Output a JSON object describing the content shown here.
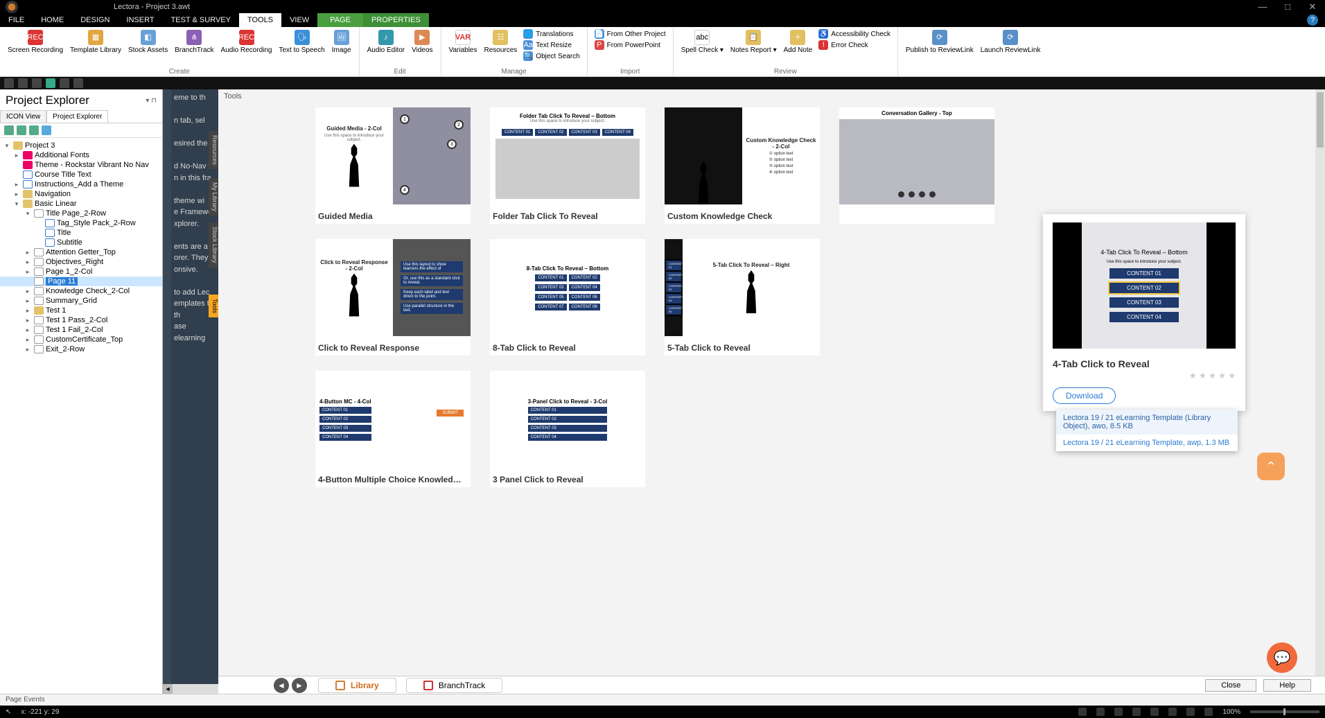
{
  "window": {
    "title": "Lectora - Project 3.awt",
    "buttons": {
      "min": "—",
      "max": "□",
      "close": "✕"
    }
  },
  "menu": {
    "file": "FILE",
    "home": "HOME",
    "design": "DESIGN",
    "insert": "INSERT",
    "test": "TEST & SURVEY",
    "tools": "TOOLS",
    "view": "VIEW",
    "page": "PAGE",
    "properties": "PROPERTIES"
  },
  "ribbon": {
    "groups": {
      "create": "Create",
      "edit": "Edit",
      "manage": "Manage",
      "import": "Import",
      "review": "Review",
      "reviewlink": ""
    },
    "screenRecording": "Screen\nRecording",
    "templateLibrary": "Template\nLibrary",
    "stockAssets": "Stock\nAssets",
    "branchTrack": "BranchTrack",
    "audioRecording": "Audio\nRecording",
    "textToSpeech": "Text to\nSpeech",
    "image": "Image",
    "audioEditor": "Audio\nEditor",
    "videos": "Videos",
    "variables": "Variables",
    "resources": "Resources",
    "translations": "Translations",
    "textResize": "Text Resize",
    "objectSearch": "Object Search",
    "fromOtherProject": "From Other Project",
    "fromPowerPoint": "From PowerPoint",
    "spellCheck": "Spell\nCheck ▾",
    "notesReport": "Notes\nReport ▾",
    "addNote": "Add Note",
    "accessibility": "Accessibility Check",
    "errorCheck": "Error Check",
    "publishReview": "Publish to\nReviewLink",
    "launchReview": "Launch\nReviewLink"
  },
  "explorer": {
    "title": "Project Explorer",
    "tabs": {
      "icon": "ICON View",
      "pe": "Project Explorer"
    },
    "tree": {
      "root": "Project 3",
      "fonts": "Additional Fonts",
      "theme": "Theme - Rockstar Vibrant No Nav",
      "courseTitle": "Course Title Text",
      "instructions": "Instructions_Add a Theme",
      "navigation": "Navigation",
      "basic": "Basic Linear",
      "titlePage": "Title Page_2-Row",
      "tagStyle": "Tag_Style Pack_2-Row",
      "title": "Title",
      "subtitle": "Subtitle",
      "attention": "Attention Getter_Top",
      "objectives": "Objectives_Right",
      "page12": "Page 1_2-Col",
      "page11": "Page 11",
      "knowledge": "Knowledge Check_2-Col",
      "summary": "Summary_Grid",
      "test1": "Test 1",
      "testPass": "Test 1 Pass_2-Col",
      "testFail": "Test 1 Fail_2-Col",
      "cert": "CustomCertificate_Top",
      "exit": "Exit_2-Row"
    }
  },
  "docstrip": {
    "fragments": [
      "eme to th",
      "n tab, sel",
      "esired the",
      "d No-Nav to",
      "n in this fra",
      "theme wi",
      "e Framewo",
      "xplorer.",
      "ents are a",
      "orer. They",
      "onsive.",
      "to add Lec",
      "emplates to th",
      "ase elearning"
    ],
    "tabs": {
      "resources": "Resources",
      "mylib": "My Library",
      "stock": "Stock Library",
      "tools": "Tools"
    }
  },
  "gallery": {
    "header": "Tools",
    "cards": {
      "guided": "Guided Media",
      "folderTab": "Folder Tab Click To Reveal",
      "customKC": "Custom Knowledge Check",
      "convGallery": "",
      "clickReveal": "Click to Reveal Response",
      "tab8": "8-Tab Click to Reveal",
      "tab5": "5-Tab Click to Reveal",
      "btn4": "4-Button Multiple Choice Knowled…",
      "panel3": "3 Panel Click to Reveal"
    },
    "thumbTitles": {
      "guided": "Guided Media - 2-Col",
      "folderTab": "Folder Tab Click To Reveal – Bottom",
      "customKC": "Custom Knowledge Check - 2-Col",
      "convGallery": "Conversation Gallery - Top",
      "clickReveal": "Click to Reveal Response - 2-Col",
      "tab8": "8-Tab Click To Reveal – Bottom",
      "tab5": "5-Tab Click To Reveal – Right",
      "btn4": "4-Button MC - 4-Col",
      "panel3": "3-Panel Click to Reveal - 3-Col"
    },
    "content": {
      "c1": "CONTENT 01",
      "c2": "CONTENT 02",
      "c3": "CONTENT 03",
      "c4": "CONTENT 04",
      "c5": "CONTENT 05",
      "c6": "CONTENT 06",
      "c7": "CONTENT 07",
      "c8": "CONTENT 08",
      "submit": "SUBMIT"
    }
  },
  "detail": {
    "thumbTitle": "4-Tab Click To Reveal – Bottom",
    "title": "4-Tab Click to Reveal",
    "stars": "★ ★ ★ ★ ★",
    "download": "Download"
  },
  "dlmenu": {
    "item1": "Lectora 19 / 21 eLearning Template (Library Object), awo, 8.5 KB",
    "item2": "Lectora 19 / 21 eLearning Template, awp, 1.3 MB"
  },
  "libbar": {
    "library": "Library",
    "branchtrack": "BranchTrack",
    "close": "Close",
    "help": "Help"
  },
  "pageEvents": "Page Events",
  "status": {
    "coords": "x: -221  y: 29",
    "zoom": "100%"
  }
}
